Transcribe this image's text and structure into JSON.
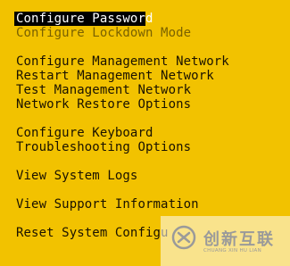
{
  "menu": {
    "items": [
      {
        "label": "Configure Password",
        "state": "selected"
      },
      {
        "label": "Configure Lockdown Mode",
        "state": "disabled"
      },
      {
        "label": "Configure Management Network",
        "state": "normal"
      },
      {
        "label": "Restart Management Network",
        "state": "normal"
      },
      {
        "label": "Test Management Network",
        "state": "normal"
      },
      {
        "label": "Network Restore Options",
        "state": "normal"
      },
      {
        "label": "Configure Keyboard",
        "state": "normal"
      },
      {
        "label": "Troubleshooting Options",
        "state": "normal"
      },
      {
        "label": "View System Logs",
        "state": "normal"
      },
      {
        "label": "View Support Information",
        "state": "normal"
      },
      {
        "label": "Reset System Configu",
        "state": "normal"
      }
    ]
  },
  "watermark": {
    "icon": "chuangxin-logo-icon",
    "text_cn": "创新互联",
    "text_en": "CHUANG XIN HU LIAN"
  },
  "colors": {
    "background": "#f2c200",
    "text": "#1a1200",
    "disabled_text": "#7a6100",
    "selected_bg": "#000000",
    "selected_text": "#ffffff"
  }
}
